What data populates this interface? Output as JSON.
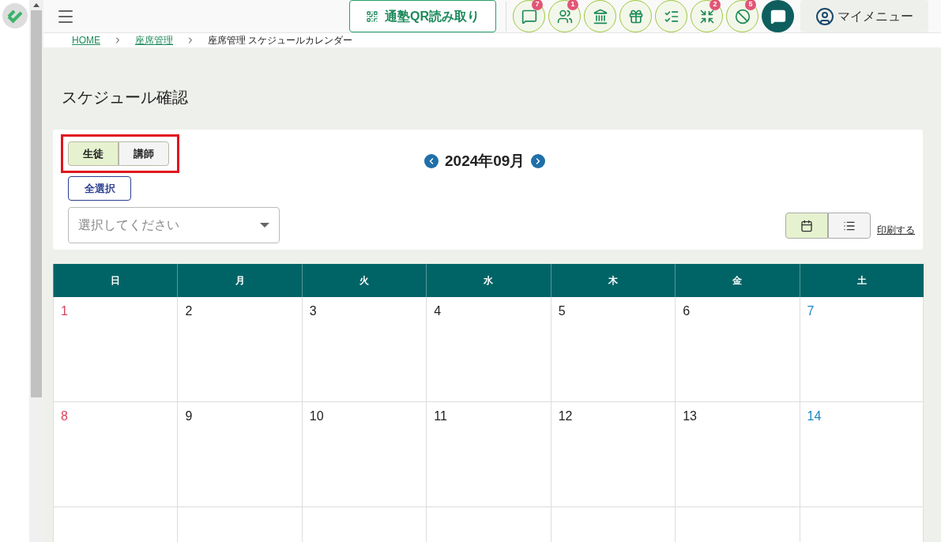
{
  "header": {
    "qr_button": "通塾QR読み取り",
    "icon_buttons": [
      {
        "kind": "message",
        "badge": "7"
      },
      {
        "kind": "people",
        "badge": "1"
      },
      {
        "kind": "bank"
      },
      {
        "kind": "gift"
      },
      {
        "kind": "checklist"
      },
      {
        "kind": "merge",
        "badge": "2"
      },
      {
        "kind": "block",
        "badge": "5"
      }
    ],
    "my_menu": "マイメニュー"
  },
  "breadcrumb": [
    {
      "label": "HOME",
      "link": true
    },
    {
      "label": "座席管理",
      "link": true
    },
    {
      "label": "座席管理 スケジュールカレンダー",
      "link": false
    }
  ],
  "page_title": "スケジュール確認",
  "toggle": [
    {
      "label": "生徒",
      "selected": true
    },
    {
      "label": "講師",
      "selected": false
    }
  ],
  "select_all": "全選択",
  "dropdown": {
    "placeholder": "選択してください"
  },
  "month": "2024年09月",
  "view_toggle": [
    {
      "kind": "calendar",
      "selected": true
    },
    {
      "kind": "list",
      "selected": false
    }
  ],
  "print_link": "印刷する",
  "weekdays": [
    "日",
    "月",
    "火",
    "水",
    "木",
    "金",
    "土"
  ],
  "weeks": [
    [
      "1",
      "2",
      "3",
      "4",
      "5",
      "6",
      "7"
    ],
    [
      "8",
      "9",
      "10",
      "11",
      "12",
      "13",
      "14"
    ]
  ]
}
